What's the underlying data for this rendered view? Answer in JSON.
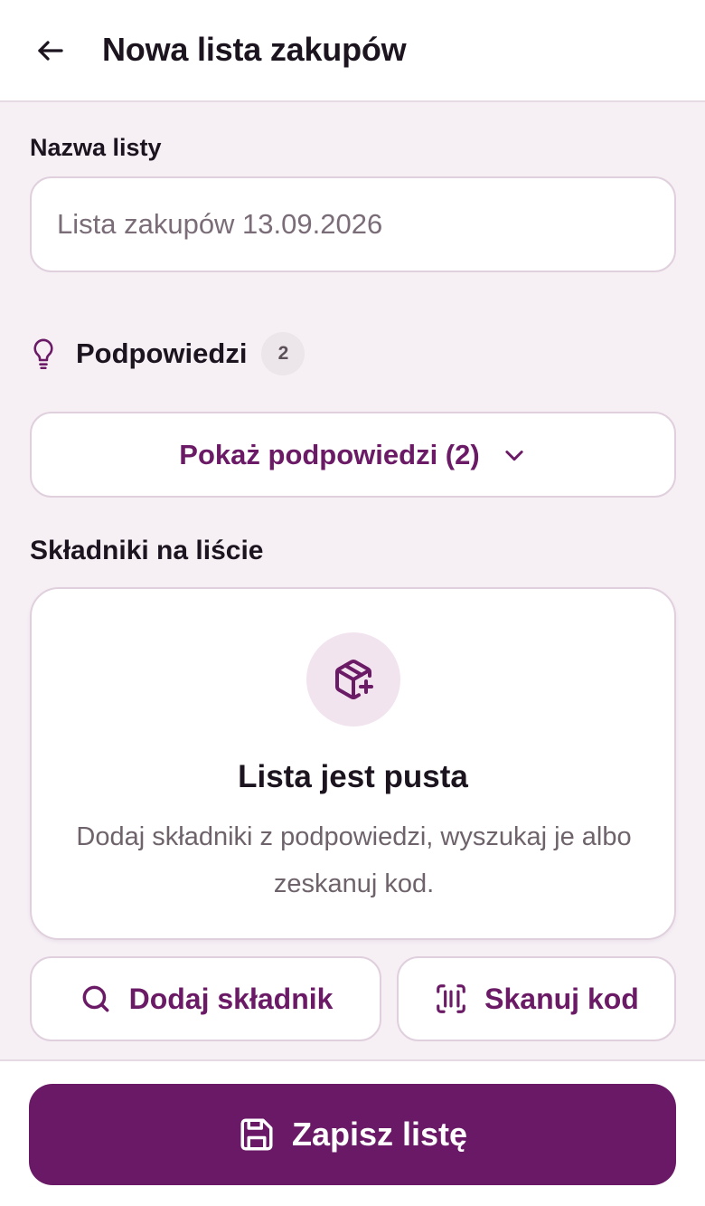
{
  "header": {
    "title": "Nowa lista zakupów",
    "back_icon": "arrow-left-icon"
  },
  "list_name": {
    "label": "Nazwa listy",
    "value": "",
    "placeholder": "Lista zakupów 13.09.2026"
  },
  "hints": {
    "icon": "lightbulb-icon",
    "title": "Podpowiedzi",
    "count": "2",
    "show_button_label": "Pokaż podpowiedzi (2)",
    "show_button_icon": "chevron-down-icon"
  },
  "items": {
    "section_label": "Składniki na liście",
    "empty_icon": "package-plus-icon",
    "empty_title": "Lista jest pusta",
    "empty_description": "Dodaj składniki z podpowiedzi, wyszukaj je albo zeskanuj kod."
  },
  "actions": {
    "add_label": "Dodaj składnik",
    "add_icon": "search-icon",
    "scan_label": "Skanuj kod",
    "scan_icon": "barcode-scan-icon"
  },
  "footer": {
    "save_label": "Zapisz listę",
    "save_icon": "save-icon"
  },
  "colors": {
    "accent": "#6a1966",
    "accent_text": "#6b1a66",
    "background": "#f6f0f5",
    "border": "#e0d0dd",
    "icon_bg": "#f1e4ef"
  }
}
